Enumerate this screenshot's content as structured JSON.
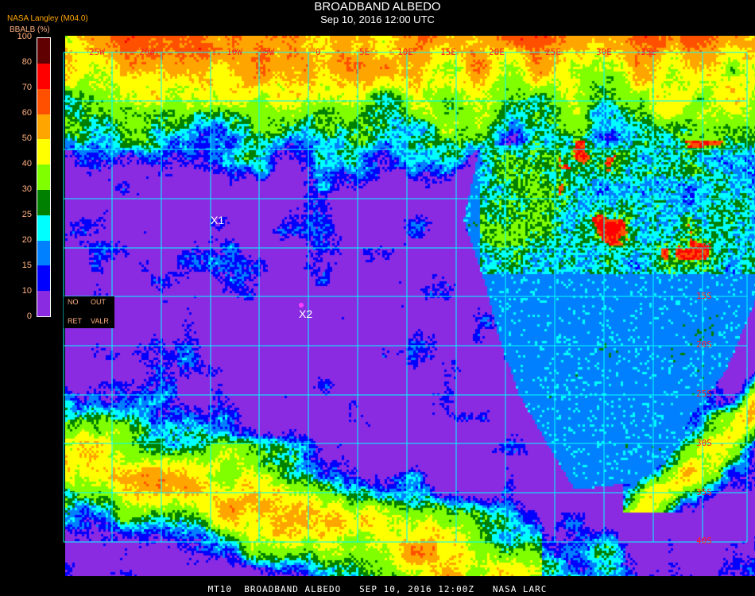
{
  "header": {
    "title": "BROADBAND ALBEDO",
    "subtitle": "Sep 10, 2016 12:00 UTC",
    "source": "NASA Langley (M04.0)",
    "unit_label": "BBALB (%)"
  },
  "legend": {
    "ticks": [
      "0",
      "10",
      "15",
      "20",
      "25",
      "30",
      "40",
      "50",
      "60",
      "70",
      "80",
      "100"
    ],
    "colors": [
      "#8a2be2",
      "#0000ff",
      "#0080ff",
      "#00ffff",
      "#008000",
      "#80ff00",
      "#ffff00",
      "#ffa500",
      "#ff5000",
      "#ff0000",
      "#600000"
    ]
  },
  "map": {
    "lon_labels": [
      "25W",
      "20W",
      "10W",
      "5W",
      "0",
      "5E",
      "10E",
      "15E",
      "20E",
      "25E",
      "30E",
      "35E"
    ],
    "lat_labels": [
      "10S",
      "15S",
      "20S",
      "25S",
      "30S",
      "35S",
      "40S"
    ],
    "markers": [
      {
        "label": "X1"
      },
      {
        "label": "X2"
      }
    ],
    "no_data_box": {
      "no": "NO",
      "out": "OUT",
      "ret": "RET",
      "valr": "VALR"
    },
    "grid_color": "#00ffff",
    "label_color": "#ff2020"
  },
  "footer": "MT10  BROADBAND ALBEDO   SEP 10, 2016 12:00Z   NASA LARC"
}
